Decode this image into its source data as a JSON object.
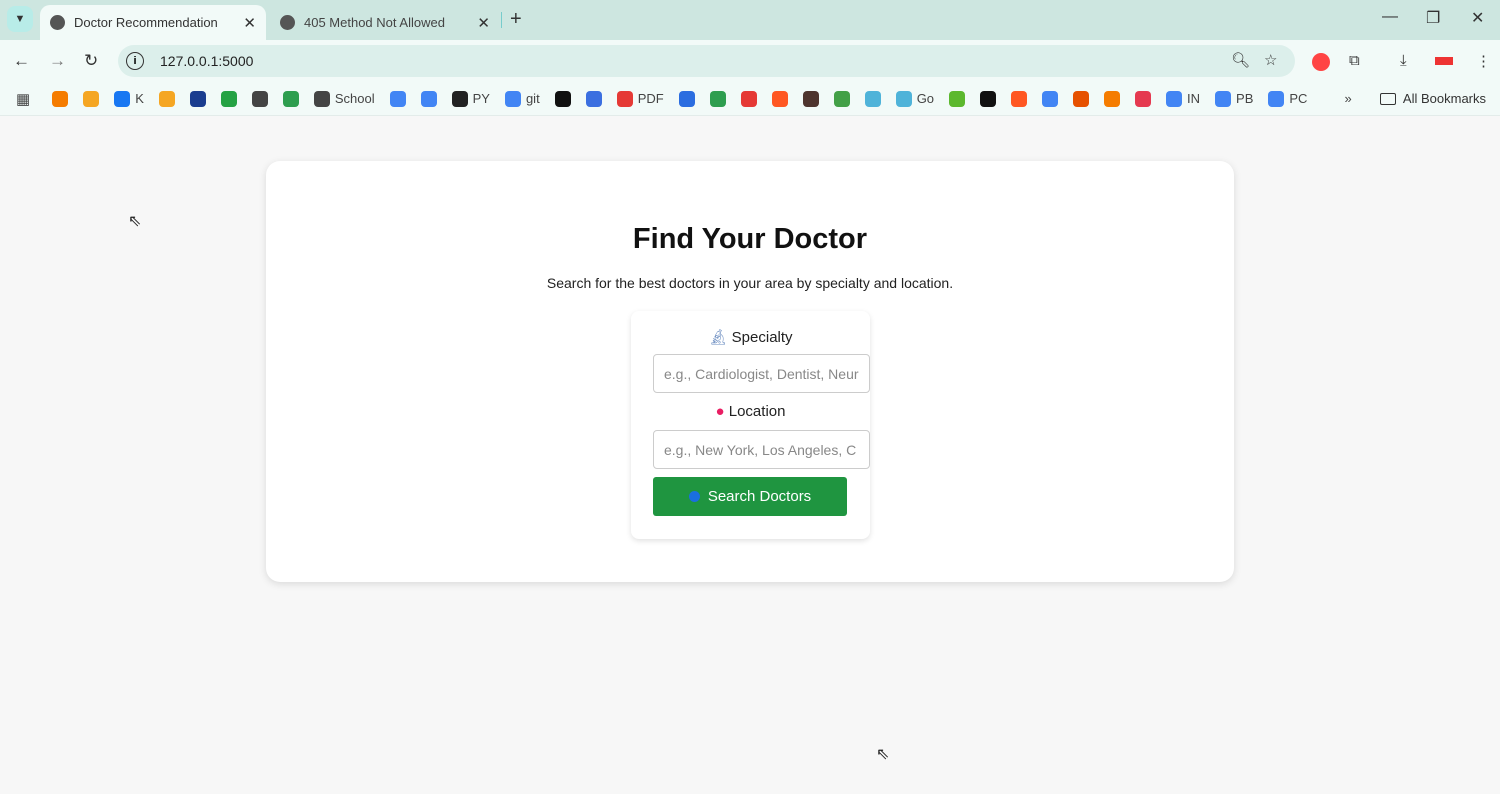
{
  "browser": {
    "tabs": [
      {
        "title": "Doctor Recommendation",
        "active": true
      },
      {
        "title": "405 Method Not Allowed",
        "active": false
      }
    ],
    "url": "127.0.0.1:5000",
    "bookmarks": [
      {
        "label": "",
        "color": "#f57c00"
      },
      {
        "label": "",
        "color": "#f5a623"
      },
      {
        "label": "K",
        "color": "#1877f2"
      },
      {
        "label": "",
        "color": "#f5a623"
      },
      {
        "label": "",
        "color": "#1a3d8f"
      },
      {
        "label": "",
        "color": "#25a244"
      },
      {
        "label": "",
        "color": "#444"
      },
      {
        "label": "",
        "color": "#2e9e4f"
      },
      {
        "label": "School",
        "color": "#444"
      },
      {
        "label": "",
        "color": "#4285f4"
      },
      {
        "label": "",
        "color": "#4285f4"
      },
      {
        "label": "PY",
        "color": "#222"
      },
      {
        "label": "git",
        "color": "#4285f4"
      },
      {
        "label": "",
        "color": "#111"
      },
      {
        "label": "",
        "color": "#3b6fe0"
      },
      {
        "label": "PDF",
        "color": "#e53935"
      },
      {
        "label": "",
        "color": "#2b6de0"
      },
      {
        "label": "",
        "color": "#2e9e4f"
      },
      {
        "label": "",
        "color": "#e53935"
      },
      {
        "label": "",
        "color": "#ff5722"
      },
      {
        "label": "",
        "color": "#4e342e"
      },
      {
        "label": "",
        "color": "#43a047"
      },
      {
        "label": "",
        "color": "#4fb3d9"
      },
      {
        "label": "Go",
        "color": "#4fb3d9"
      },
      {
        "label": "",
        "color": "#5cb82e"
      },
      {
        "label": "",
        "color": "#111"
      },
      {
        "label": "",
        "color": "#ff5722"
      },
      {
        "label": "",
        "color": "#4285f4"
      },
      {
        "label": "",
        "color": "#e65100"
      },
      {
        "label": "",
        "color": "#f57c00"
      },
      {
        "label": "",
        "color": "#e53950"
      },
      {
        "label": "IN",
        "color": "#4285f4"
      },
      {
        "label": "PB",
        "color": "#4285f4"
      },
      {
        "label": "PC",
        "color": "#4285f4"
      }
    ],
    "all_bookmarks": "All Bookmarks"
  },
  "page": {
    "title": "Find Your Doctor",
    "subtitle": "Search for the best doctors in your area by specialty and location.",
    "specialty_label": "Specialty",
    "specialty_placeholder": "e.g., Cardiologist, Dentist, Neur",
    "location_label": "Location",
    "location_placeholder": "e.g., New York, Los Angeles, C",
    "search_button": "Search Doctors",
    "specialty_icon": "microscope-icon",
    "location_icon": "pushpin-icon",
    "button_color": "#1f9540"
  }
}
